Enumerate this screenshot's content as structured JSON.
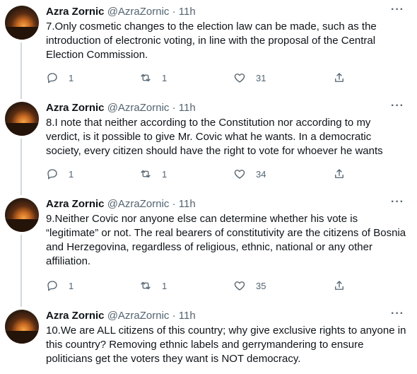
{
  "tweets": [
    {
      "name": "Azra Zornic",
      "handle": "@AzraZornic",
      "dot": "·",
      "time": "11h",
      "text": "7.Only cosmetic changes to the election law can be made, such as the introduction of electronic voting, in line with the proposal of the Central Election Commission.",
      "replies": "1",
      "retweets": "1",
      "likes": "31"
    },
    {
      "name": "Azra Zornic",
      "handle": "@AzraZornic",
      "dot": "·",
      "time": "11h",
      "text": "8.I note that neither according to the Constitution nor according to my verdict, is it possible to give Mr. Covic what he wants. In a democratic society, every citizen should have the right to vote for whoever he wants",
      "replies": "1",
      "retweets": "1",
      "likes": "34"
    },
    {
      "name": "Azra Zornic",
      "handle": "@AzraZornic",
      "dot": "·",
      "time": "11h",
      "text": "9.Neither Covic nor anyone else can determine whether his vote is “legitimate” or not. The real bearers of constitutivity are the citizens of Bosnia and Herzegovina, regardless of religious, ethnic, national or any other affiliation.",
      "replies": "1",
      "retweets": "1",
      "likes": "35"
    },
    {
      "name": "Azra Zornic",
      "handle": "@AzraZornic",
      "dot": "·",
      "time": "11h",
      "text": "10.We are ALL citizens of this country; why give exclusive rights to anyone in this country? Removing ethnic labels and gerrymandering to ensure politicians get the voters they want is NOT democracy."
    }
  ],
  "more_label": "···",
  "icons": {
    "reply": "reply-icon",
    "retweet": "retweet-icon",
    "like": "heart-icon",
    "share": "share-icon",
    "more": "more-icon"
  }
}
